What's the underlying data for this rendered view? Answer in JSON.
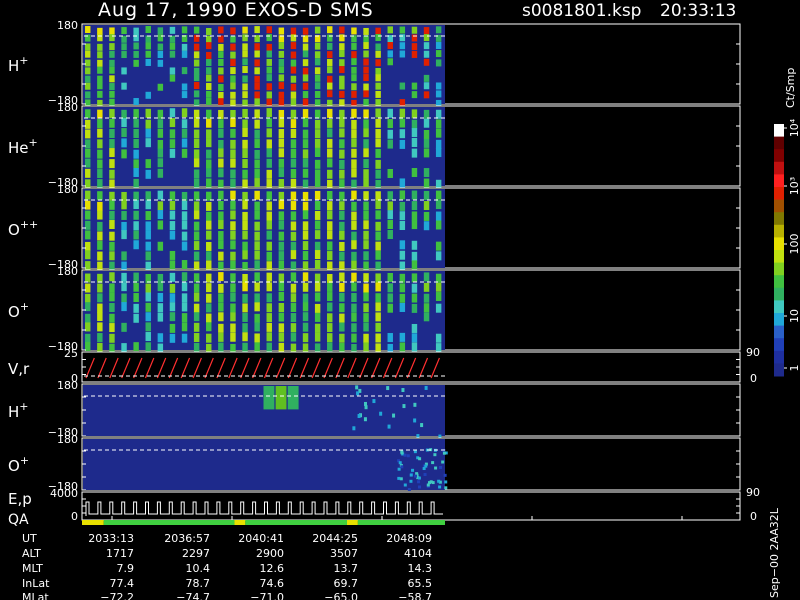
{
  "header": {
    "title": "Aug 17, 1990    EXOS-D SMS",
    "file": "s0081801.ksp",
    "time": "20:33:13"
  },
  "colorbar": {
    "label": "Ct/Smp",
    "ticks": [
      "1",
      "10",
      "100",
      "10³",
      "10⁴"
    ],
    "colors": [
      "#1e2a8c",
      "#1e2fa0",
      "#2040b8",
      "#2a60c8",
      "#20a8d8",
      "#40c8c0",
      "#30b060",
      "#40c040",
      "#80d020",
      "#c0e010",
      "#e8e000",
      "#b8b000",
      "#807800",
      "#a05000",
      "#e02000",
      "#ff2020",
      "#c01010",
      "#800000",
      "#600000",
      "#ffffff"
    ]
  },
  "panels": [
    {
      "name": "h-plus",
      "label": "H",
      "sup": "+",
      "ytop": "180",
      "ybot": "−180",
      "type": "spectrogram",
      "intensity": "high"
    },
    {
      "name": "he-plus",
      "label": "He",
      "sup": "+",
      "ytop": "180",
      "ybot": "−180",
      "type": "spectrogram",
      "intensity": "med"
    },
    {
      "name": "o-plus-plus",
      "label": "O",
      "sup": "++",
      "ytop": "180",
      "ybot": "−180",
      "type": "spectrogram",
      "intensity": "med"
    },
    {
      "name": "o-plus",
      "label": "O",
      "sup": "+",
      "ytop": "180",
      "ybot": "−180",
      "type": "spectrogram",
      "intensity": "med"
    },
    {
      "name": "vr",
      "label": "V,r",
      "sup": "",
      "ytop": "25",
      "ybot": "0",
      "rtop": "90",
      "rbot": "0",
      "type": "sawtooth"
    },
    {
      "name": "h-plus-2",
      "label": "H",
      "sup": "+",
      "ytop": "180",
      "ybot": "−180",
      "type": "spectrogram",
      "intensity": "low-h"
    },
    {
      "name": "o-plus-2",
      "label": "O",
      "sup": "+",
      "ytop": "180",
      "ybot": "−180",
      "type": "spectrogram",
      "intensity": "low-o"
    },
    {
      "name": "ep-qa",
      "label": "E,p",
      "label2": "QA",
      "sup": "",
      "ytop": "4000",
      "ybot": "0",
      "rtop": "90",
      "rbot": "0",
      "type": "steps"
    }
  ],
  "ephemeris": {
    "row_labels": [
      "UT",
      "ALT",
      "MLT",
      "InLat",
      "MLat"
    ],
    "columns": [
      [
        "2033:13",
        "1717",
        "7.9",
        "77.4",
        "−72.2"
      ],
      [
        "2036:57",
        "2297",
        "10.4",
        "78.7",
        "−74.7"
      ],
      [
        "2040:41",
        "2900",
        "12.6",
        "74.6",
        "−71.0"
      ],
      [
        "2044:25",
        "3507",
        "13.7",
        "69.7",
        "−65.0"
      ],
      [
        "2048:09",
        "4104",
        "14.3",
        "65.5",
        "−58.7"
      ]
    ]
  },
  "footer_note": "Sep−00  2AA32L",
  "qa_bar": {
    "segments": [
      {
        "color": "#e8e000",
        "frac": 0.06
      },
      {
        "color": "#40d040",
        "frac": 0.36
      },
      {
        "color": "#e8e000",
        "frac": 0.03
      },
      {
        "color": "#40d040",
        "frac": 0.28
      },
      {
        "color": "#e8e000",
        "frac": 0.03
      },
      {
        "color": "#40d040",
        "frac": 0.24
      }
    ]
  }
}
